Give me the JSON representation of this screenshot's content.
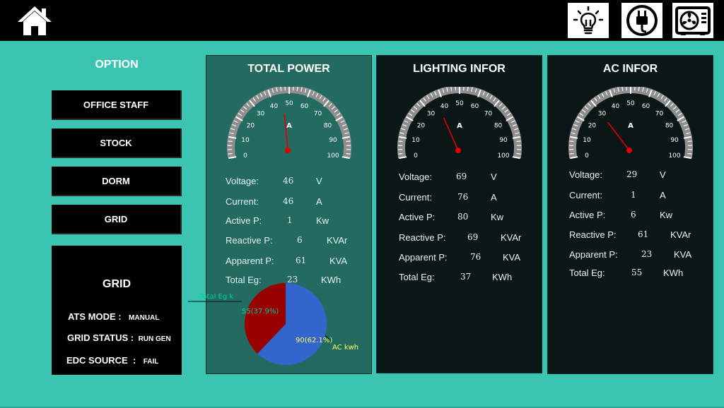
{
  "header": {
    "home_icon": "home-icon",
    "right_icons": [
      "lightbulb-icon",
      "power-plug-icon",
      "air-conditioner-icon"
    ]
  },
  "sidebar": {
    "title": "OPTION",
    "buttons": [
      "OFFICE STAFF",
      "STOCK",
      "DORM",
      "GRID"
    ],
    "status": {
      "title": "GRID",
      "rows": [
        {
          "label": "ATS MODE :",
          "value": "MANUAL"
        },
        {
          "label": "GRID STATUS :",
          "value": "RUN GEN"
        },
        {
          "label": "EDC SOURCE  :",
          "value": "FAIL"
        }
      ]
    }
  },
  "panels": [
    {
      "title": "TOTAL POWER",
      "gauge": {
        "unit": "A",
        "value": 46,
        "min": 0,
        "max": 100,
        "ticks": [
          "0",
          "10",
          "20",
          "30",
          "40",
          "50",
          "60",
          "70",
          "80",
          "90",
          "100"
        ]
      },
      "readings": [
        {
          "label": "Voltage:",
          "value": "46",
          "unit": "V"
        },
        {
          "label": "Current:",
          "value": "46",
          "unit": "A"
        },
        {
          "label": "Active P:",
          "value": "1",
          "unit": "Kw"
        },
        {
          "label": "Reactive P:",
          "value": "6",
          "unit": "KVAr"
        },
        {
          "label": "Apparent P:",
          "value": "61",
          "unit": "KVA"
        },
        {
          "label": "Total Eg:",
          "value": "23",
          "unit": "KWh"
        }
      ],
      "pie": {
        "slices": [
          {
            "name": "Total Eg k",
            "value": 55,
            "label": "55(37.9%)",
            "color": "#990000"
          },
          {
            "name": "AC kwh",
            "value": 90,
            "label": "90(62.1%)",
            "color": "#3366cc"
          }
        ]
      }
    },
    {
      "title": "LIGHTING INFOR",
      "gauge": {
        "unit": "A",
        "value": 36,
        "min": 0,
        "max": 100,
        "ticks": [
          "0",
          "10",
          "20",
          "30",
          "40",
          "50",
          "60",
          "70",
          "80",
          "90",
          "100"
        ]
      },
      "readings": [
        {
          "label": "Voltage:",
          "value": "69",
          "unit": "V"
        },
        {
          "label": "Current:",
          "value": "76",
          "unit": "A"
        },
        {
          "label": "Active P:",
          "value": "80",
          "unit": "Kw"
        },
        {
          "label": "Reactive P:",
          "value": "69",
          "unit": "KVAr"
        },
        {
          "label": "Apparent P:",
          "value": "76",
          "unit": "KVA"
        },
        {
          "label": "Total Eg:",
          "value": "37",
          "unit": "KWh"
        }
      ]
    },
    {
      "title": "AC INFOR",
      "gauge": {
        "unit": "A",
        "value": 29,
        "min": 0,
        "max": 100,
        "ticks": [
          "0",
          "10",
          "20",
          "30",
          "40",
          "50",
          "60",
          "70",
          "80",
          "90",
          "100"
        ]
      },
      "readings": [
        {
          "label": "Voltage:",
          "value": "29",
          "unit": "V"
        },
        {
          "label": "Current:",
          "value": "1",
          "unit": "A"
        },
        {
          "label": "Active P:",
          "value": "6",
          "unit": "Kw"
        },
        {
          "label": "Reactive P:",
          "value": "61",
          "unit": "KVAr"
        },
        {
          "label": "Apparent P:",
          "value": "23",
          "unit": "KVA"
        },
        {
          "label": "Total Eg:",
          "value": "55",
          "unit": "KWh"
        }
      ]
    }
  ]
}
